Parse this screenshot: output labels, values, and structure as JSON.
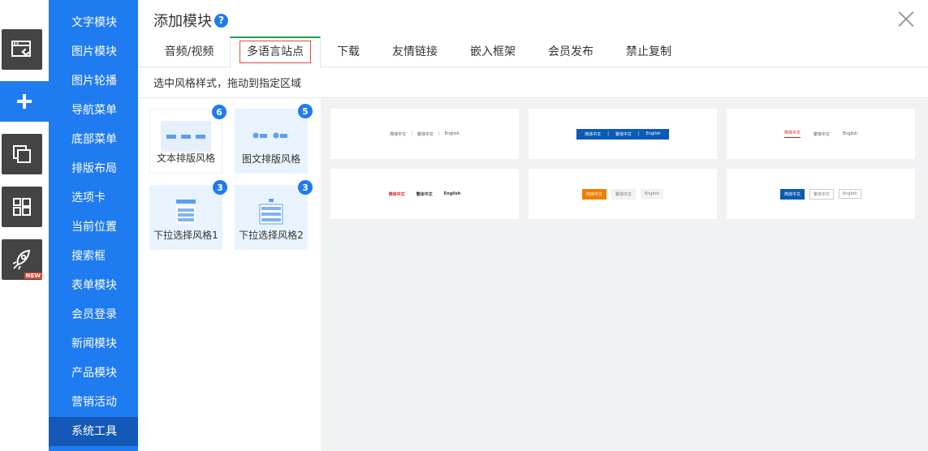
{
  "strip": {
    "items": [
      {
        "name": "page-settings",
        "icon": "window-wrench-icon",
        "active": false
      },
      {
        "name": "add-module",
        "icon": "plus-icon",
        "active": true
      },
      {
        "name": "pages",
        "icon": "copy-pages-icon",
        "active": false
      },
      {
        "name": "layout",
        "icon": "grid-icon",
        "active": false
      },
      {
        "name": "launch",
        "icon": "rocket-icon",
        "active": false,
        "badge": "NEW"
      }
    ]
  },
  "categories": [
    {
      "label": "文字模块"
    },
    {
      "label": "图片模块"
    },
    {
      "label": "图片轮播"
    },
    {
      "label": "导航菜单"
    },
    {
      "label": "底部菜单"
    },
    {
      "label": "排版布局"
    },
    {
      "label": "选项卡"
    },
    {
      "label": "当前位置"
    },
    {
      "label": "搜索框"
    },
    {
      "label": "表单模块"
    },
    {
      "label": "会员登录"
    },
    {
      "label": "新闻模块"
    },
    {
      "label": "产品模块"
    },
    {
      "label": "营销活动"
    },
    {
      "label": "系统工具",
      "active": true
    }
  ],
  "dialog": {
    "title": "添加模块",
    "help_icon": "?",
    "instruction": "选中风格样式，拖动到指定区域",
    "tabs": [
      {
        "label": "音频/视频"
      },
      {
        "label": "多语言站点",
        "active": true
      },
      {
        "label": "下载"
      },
      {
        "label": "友情链接"
      },
      {
        "label": "嵌入框架"
      },
      {
        "label": "会员发布"
      },
      {
        "label": "禁止复制"
      }
    ],
    "styles": [
      {
        "label": "文本排版风格",
        "count": "6",
        "selected": true
      },
      {
        "label": "图文排版风格",
        "count": "5"
      },
      {
        "label": "下拉选择风格1",
        "count": "3"
      },
      {
        "label": "下拉选择风格2",
        "count": "3"
      }
    ],
    "preview_lang": {
      "simplified": "简体中文",
      "traditional": "繁体中文",
      "english": "English",
      "sep": "|"
    }
  },
  "colors": {
    "accent": "#1f7bf0",
    "active_category": "#1559b8",
    "tab_top": "#21a04a",
    "tab_outline": "#e84a3a",
    "strip_dark": "#444444"
  }
}
